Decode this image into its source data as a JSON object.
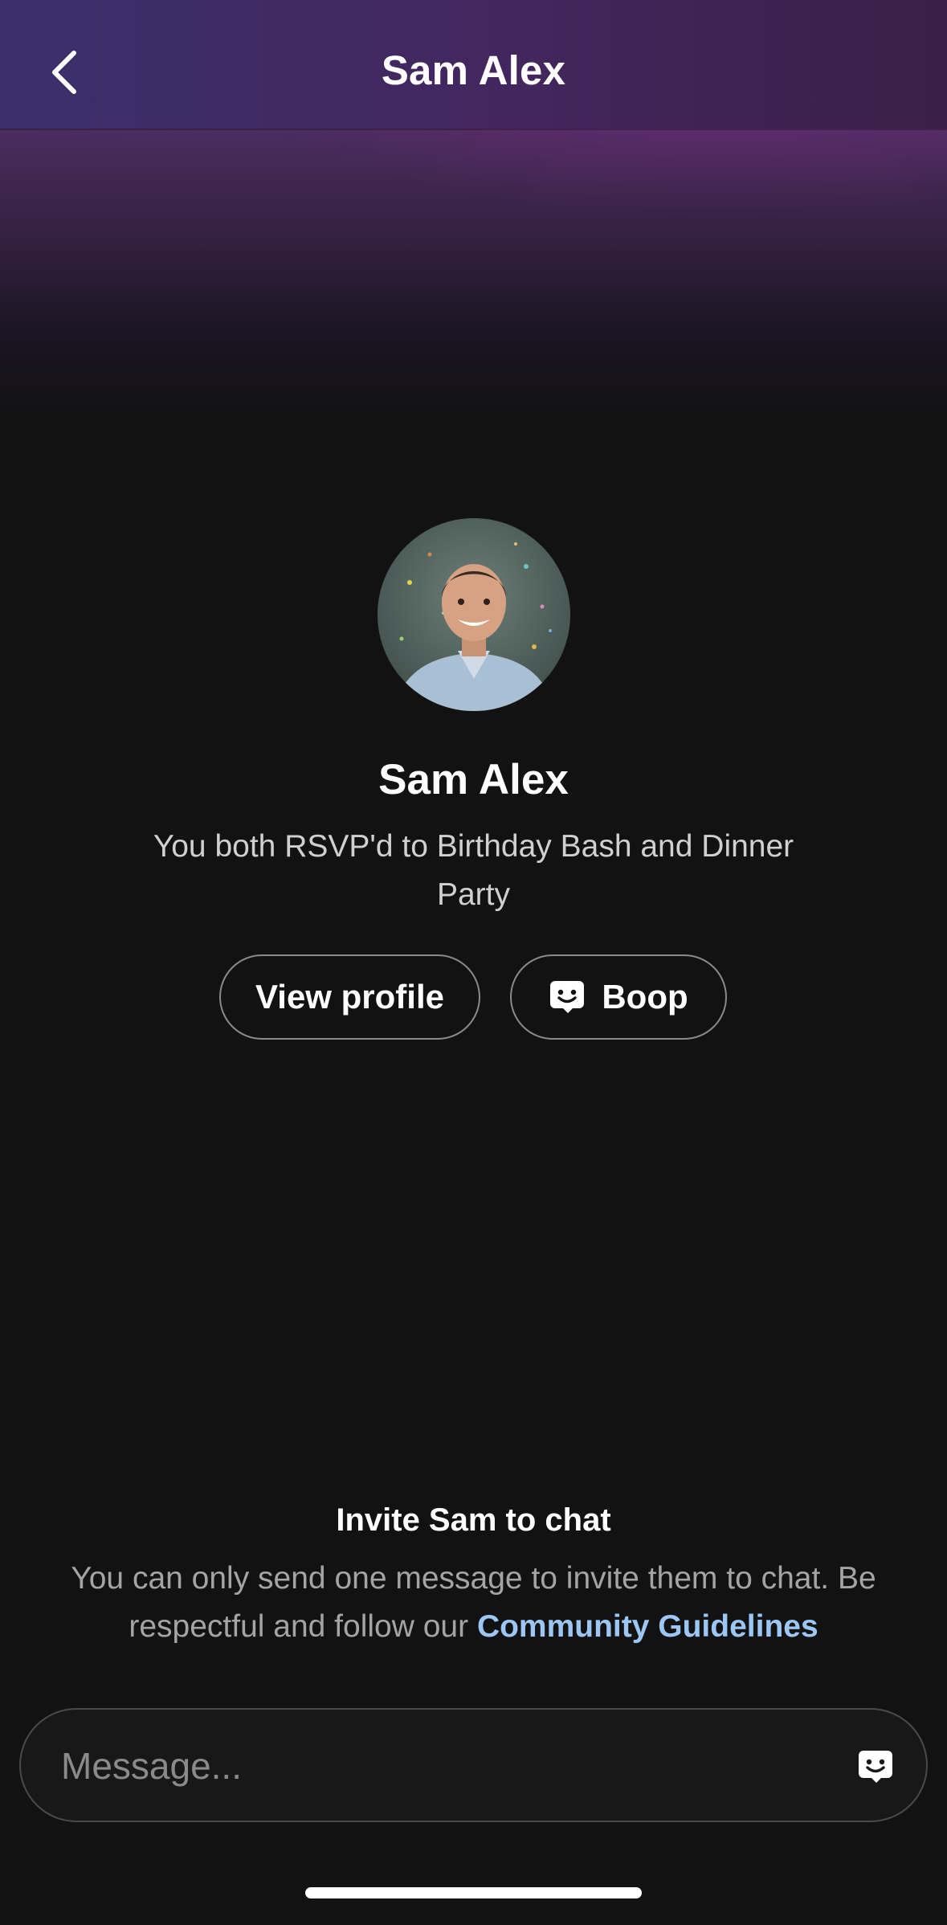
{
  "colors": {
    "background": "#121212",
    "nav_gradient_start": "#3b2f6b",
    "nav_gradient_end": "#3a1f49",
    "link": "#9cc7f5",
    "muted_text": "#a4a4a4"
  },
  "header": {
    "title": "Sam Alex",
    "back_icon": "chevron-left-icon"
  },
  "profile": {
    "avatar_icon": "avatar-photo",
    "name": "Sam Alex",
    "mutual_text": "You both RSVP'd to Birthday Bash and Dinner Party",
    "view_profile_label": "View profile",
    "boop_label": "Boop",
    "boop_icon": "boop-face-icon"
  },
  "invite": {
    "title": "Invite Sam to chat",
    "text": "You can only send one message to invite them to chat. Be respectful and follow our",
    "link_label": "Community Guidelines"
  },
  "composer": {
    "placeholder": "Message...",
    "value": "",
    "send_icon": "boop-face-icon"
  }
}
